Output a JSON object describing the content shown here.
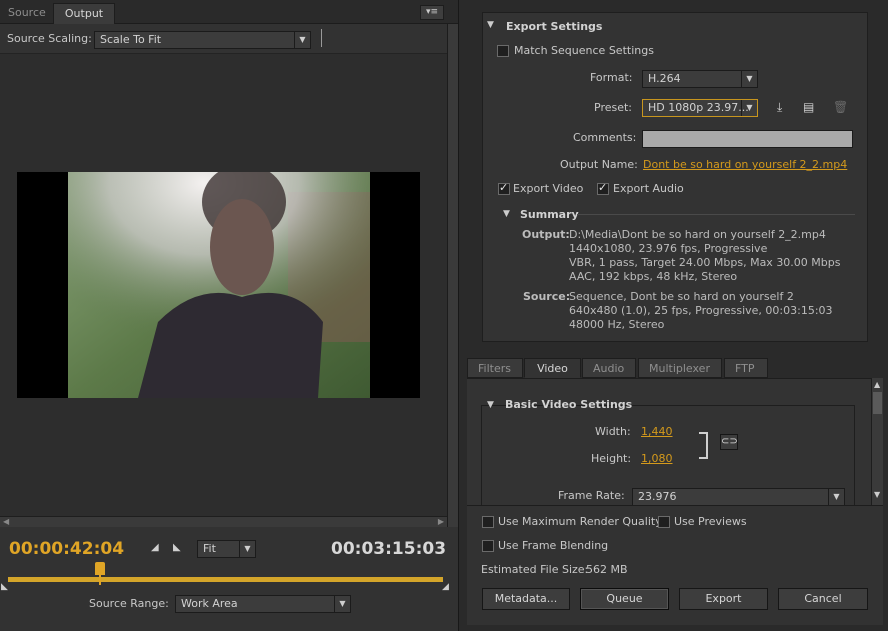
{
  "left": {
    "tabs": [
      "Source",
      "Output"
    ],
    "source_scaling_label": "Source Scaling:",
    "source_scaling_value": "Scale To Fit",
    "current_time": "00:00:42:04",
    "duration": "00:03:15:03",
    "zoom_value": "Fit",
    "source_range_label": "Source Range:",
    "source_range_value": "Work Area"
  },
  "export_settings": {
    "header": "Export Settings",
    "match_sequence": "Match Sequence Settings",
    "format_label": "Format:",
    "format_value": "H.264",
    "preset_label": "Preset:",
    "preset_value": "HD 1080p 23.97...",
    "comments_label": "Comments:",
    "output_name_label": "Output Name:",
    "output_name_value": "Dont be so hard on yourself 2_2.mp4",
    "export_video": "Export Video",
    "export_audio": "Export Audio",
    "summary_header": "Summary",
    "output_label": "Output:",
    "output_lines": [
      "D:\\Media\\Dont be so hard on yourself 2_2.mp4",
      "1440x1080, 23.976 fps, Progressive",
      "VBR, 1 pass, Target 24.00 Mbps, Max 30.00 Mbps",
      "AAC, 192 kbps, 48 kHz, Stereo"
    ],
    "source_label": "Source:",
    "source_lines": [
      "Sequence, Dont be so hard on yourself 2",
      "640x480 (1.0), 25 fps, Progressive, 00:03:15:03",
      "48000 Hz, Stereo"
    ]
  },
  "tabs2": [
    "Filters",
    "Video",
    "Audio",
    "Multiplexer",
    "FTP"
  ],
  "video": {
    "header": "Basic Video Settings",
    "width_label": "Width:",
    "width_value": "1,440",
    "height_label": "Height:",
    "height_value": "1,080",
    "frame_rate_label": "Frame Rate:",
    "frame_rate_value": "23.976"
  },
  "bottom": {
    "max_render": "Use Maximum Render Quality",
    "use_previews": "Use Previews",
    "frame_blending": "Use Frame Blending",
    "file_size_label": "Estimated File Size:",
    "file_size_value": "562 MB",
    "metadata": "Metadata...",
    "queue": "Queue",
    "export": "Export",
    "cancel": "Cancel"
  },
  "colors": {
    "accent": "#d49a1c",
    "timecode": "#e0a526",
    "bg": "#2b2b2b"
  }
}
